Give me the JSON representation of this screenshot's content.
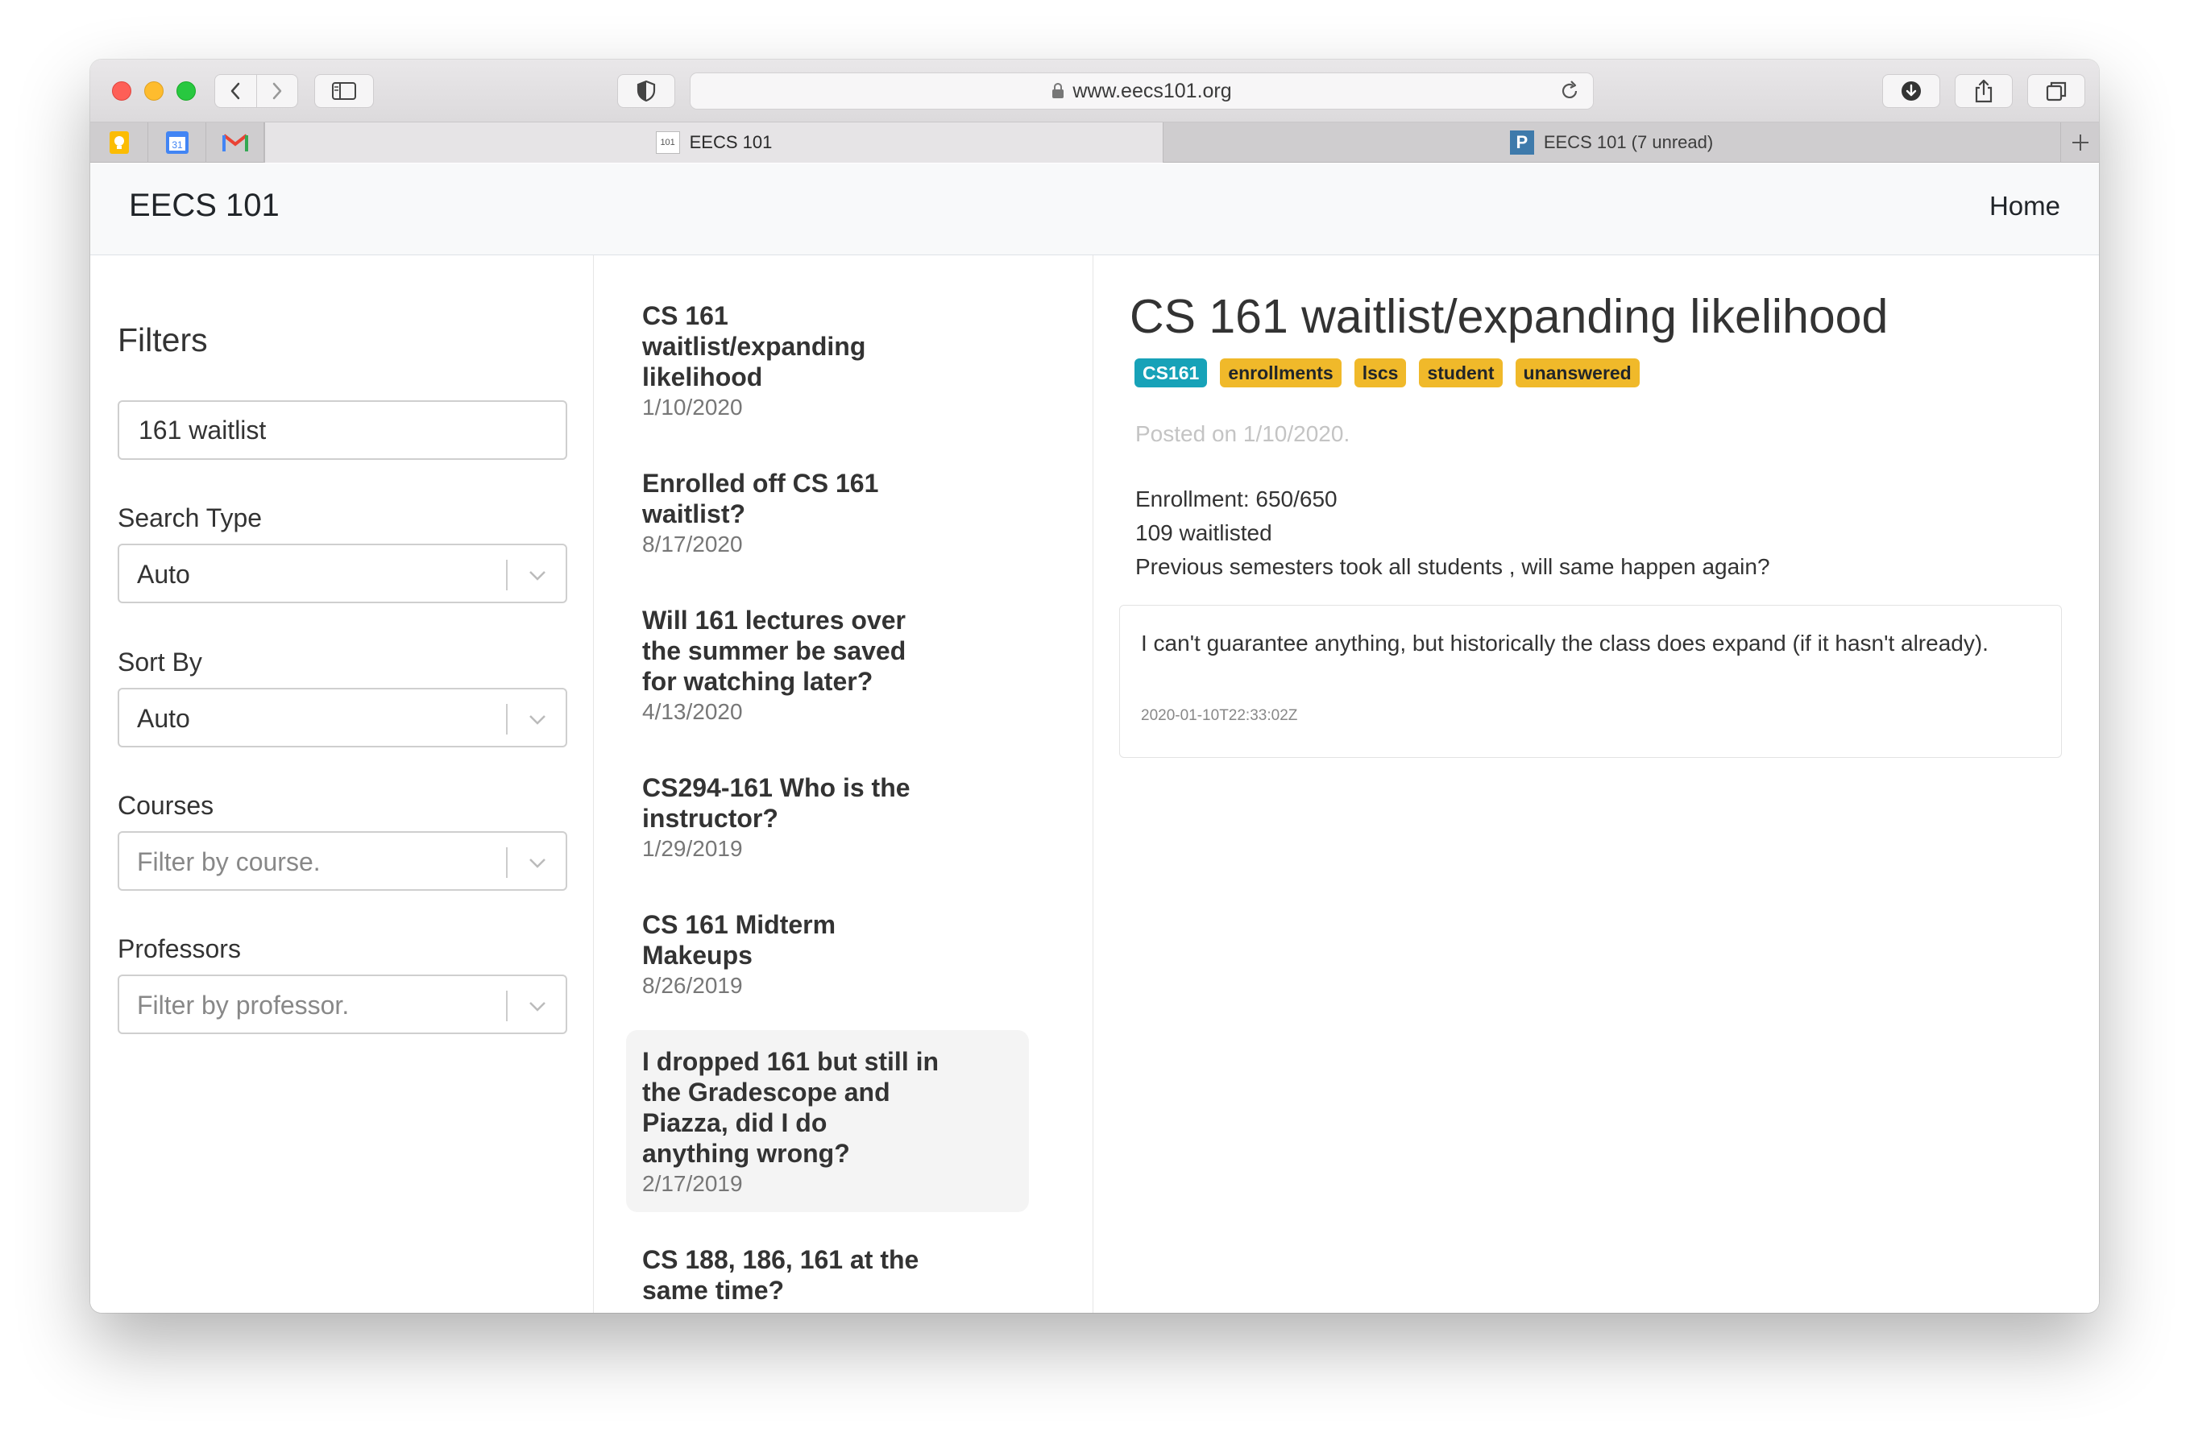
{
  "browser": {
    "url": "www.eecs101.org",
    "tabs": [
      {
        "label": "EECS 101",
        "favicon_text": "101"
      },
      {
        "label": "EECS 101 (7 unread)",
        "favicon_text": "P"
      }
    ],
    "pinned_tabs": [
      {
        "name": "keep"
      },
      {
        "name": "calendar",
        "text": "31"
      },
      {
        "name": "gmail",
        "text": "M"
      }
    ]
  },
  "navbar": {
    "brand": "EECS 101",
    "home": "Home"
  },
  "filters": {
    "title": "Filters",
    "search_value": "161 waitlist",
    "search_type_label": "Search Type",
    "search_type_value": "Auto",
    "sort_by_label": "Sort By",
    "sort_by_value": "Auto",
    "courses_label": "Courses",
    "courses_placeholder": "Filter by course.",
    "professors_label": "Professors",
    "professors_placeholder": "Filter by professor."
  },
  "results": [
    {
      "title_lines": [
        "CS 161",
        "waitlist/expanding",
        "likelihood"
      ],
      "date": "1/10/2020"
    },
    {
      "title_lines": [
        "Enrolled off CS 161",
        "waitlist?"
      ],
      "date": "8/17/2020"
    },
    {
      "title_lines": [
        "Will 161 lectures over",
        "the summer be saved",
        "for watching later?"
      ],
      "date": "4/13/2020"
    },
    {
      "title_lines": [
        "CS294-161 Who is the",
        "instructor?"
      ],
      "date": "1/29/2019"
    },
    {
      "title_lines": [
        "CS 161 Midterm",
        "Makeups"
      ],
      "date": "8/26/2019"
    },
    {
      "title_lines": [
        "I dropped 161 but still in",
        "the Gradescope and",
        "Piazza, did I do",
        "anything wrong?"
      ],
      "date": "2/17/2019"
    },
    {
      "title_lines": [
        "CS 188, 186, 161 at the",
        "same time?"
      ],
      "date": ""
    }
  ],
  "detail": {
    "title": "CS 161 waitlist/expanding likelihood",
    "tags": [
      "CS161",
      "enrollments",
      "lscs",
      "student",
      "unanswered"
    ],
    "posted": "Posted on 1/10/2020.",
    "body": [
      "Enrollment: 650/650",
      "109 waitlisted",
      "Previous semesters took all students , will same happen again?"
    ],
    "answer": {
      "text": "I can't guarantee anything, but historically the class does expand (if it hasn't already).",
      "timestamp": "2020-01-10T22:33:02Z"
    }
  },
  "colors": {
    "tag_primary": "#17a2b8",
    "tag_warning": "#f0b92a"
  }
}
